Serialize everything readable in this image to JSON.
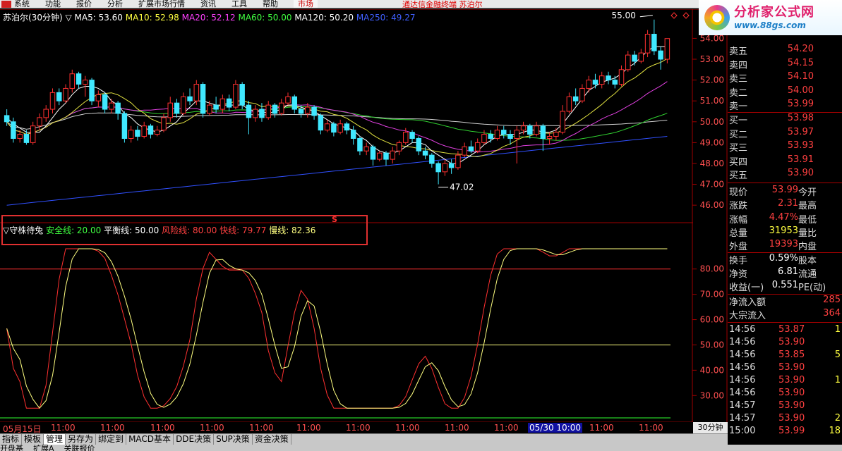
{
  "menubar": {
    "items": [
      "系统",
      "功能",
      "报价",
      "分析",
      "扩展市场行情",
      "资讯",
      "工具",
      "帮助"
    ],
    "market": "市场",
    "title": "通达信金融终端 苏泊尔"
  },
  "brand": {
    "name": "分析家公式网",
    "url": "www.88gs.com"
  },
  "main_chart": {
    "title": "苏泊尔(30分钟) ▽",
    "ma": [
      {
        "label": "MA5: 53.60",
        "color": "#ffffff"
      },
      {
        "label": "MA10: 52.98",
        "color": "#ffff40"
      },
      {
        "label": "MA20: 52.12",
        "color": "#ff40ff"
      },
      {
        "label": "MA60: 50.00",
        "color": "#40ff40"
      },
      {
        "label": "MA120: 50.20",
        "color": "#ffffff"
      },
      {
        "label": "MA250: 49.27",
        "color": "#4060ff"
      }
    ],
    "high_label": "55.00",
    "low_label": "47.02",
    "signal": "S",
    "yticks": [
      "54.00",
      "53.00",
      "52.00",
      "51.00",
      "50.00",
      "49.00",
      "48.00",
      "47.00",
      "46.00"
    ]
  },
  "indicator": {
    "title": "▽守株待兔",
    "lines": [
      {
        "label": "安全线: 20.00",
        "color": "#40ff40"
      },
      {
        "label": "平衡线: 50.00",
        "color": "#ffffff"
      },
      {
        "label": "风险线: 80.00",
        "color": "#ff4040"
      },
      {
        "label": "快线: 79.77",
        "color": "#ff4040"
      },
      {
        "label": "慢线: 82.36",
        "color": "#ffff80"
      }
    ],
    "yticks": [
      "80.00",
      "70.00",
      "60.00",
      "50.00",
      "40.00",
      "30.00"
    ]
  },
  "x_axis": {
    "labels": [
      "05月15日",
      "11:00",
      "11:00",
      "11:00",
      "11:00",
      "11:00",
      "11:00",
      "11:00",
      "11:00",
      "11:00",
      "11:00",
      "05/30 10:00",
      "11:00",
      "11:00",
      "11:00"
    ],
    "period": "30分钟"
  },
  "order_book": [
    {
      "label": "卖五",
      "price": "54.20"
    },
    {
      "label": "卖四",
      "price": "54.15"
    },
    {
      "label": "卖三",
      "price": "54.10"
    },
    {
      "label": "卖二",
      "price": "54.00"
    },
    {
      "label": "卖一",
      "price": "53.99"
    },
    {
      "label": "买一",
      "price": "53.98"
    },
    {
      "label": "买二",
      "price": "53.97"
    },
    {
      "label": "买三",
      "price": "53.93"
    },
    {
      "label": "买四",
      "price": "53.91"
    },
    {
      "label": "买五",
      "price": "53.90"
    }
  ],
  "quote": [
    {
      "l": "现价",
      "v": "53.99",
      "vc": "red",
      "r": "今开"
    },
    {
      "l": "涨跌",
      "v": "2.31",
      "vc": "red",
      "r": "最高"
    },
    {
      "l": "涨幅",
      "v": "4.47%",
      "vc": "red",
      "r": "最低"
    },
    {
      "l": "总量",
      "v": "31953",
      "vc": "yel",
      "r": "量比"
    },
    {
      "l": "外盘",
      "v": "19393",
      "vc": "red",
      "r": "内盘"
    },
    {
      "l": "换手",
      "v": "0.59%",
      "vc": "wht",
      "r": "股本"
    },
    {
      "l": "净资",
      "v": "6.81",
      "vc": "wht",
      "r": "流通"
    },
    {
      "l": "收益(一)",
      "v": "0.551",
      "vc": "wht",
      "r": "PE(动)"
    }
  ],
  "flows": [
    {
      "l": "净流入额",
      "v": "285"
    },
    {
      "l": "大宗流入",
      "v": "364"
    }
  ],
  "ticks": [
    {
      "t": "14:56",
      "p": "53.87",
      "q": "1"
    },
    {
      "t": "14:56",
      "p": "53.90",
      "q": ""
    },
    {
      "t": "14:56",
      "p": "53.85",
      "q": "5"
    },
    {
      "t": "14:56",
      "p": "53.90",
      "q": ""
    },
    {
      "t": "14:56",
      "p": "53.90",
      "q": "1"
    },
    {
      "t": "14:56",
      "p": "53.90",
      "q": ""
    },
    {
      "t": "14:57",
      "p": "53.90",
      "q": ""
    },
    {
      "t": "14:57",
      "p": "53.90",
      "q": "2"
    },
    {
      "t": "15:00",
      "p": "53.99",
      "q": "18"
    }
  ],
  "bottom_tabs": [
    "指标",
    "模板",
    "管理",
    "另存为",
    "绑定到",
    "MACD基本",
    "DDE决策",
    "SUP决策",
    "资金决策"
  ],
  "bottom_tabs2": [
    "开盘基",
    "扩展A",
    "关联报价"
  ],
  "scroll": {
    "prev": "-",
    "next": "+"
  },
  "chart_data": {
    "type": "candlestick",
    "price_range": [
      45.6,
      55.4
    ],
    "candles": [
      [
        50.3,
        50.0,
        50.6,
        49.8
      ],
      [
        50.0,
        49.2,
        50.2,
        49.0
      ],
      [
        49.2,
        49.4,
        49.6,
        49.0
      ],
      [
        49.4,
        49.0,
        49.6,
        48.9
      ],
      [
        49.0,
        49.8,
        50.0,
        48.9
      ],
      [
        49.8,
        50.2,
        50.4,
        49.6
      ],
      [
        50.2,
        50.6,
        50.8,
        50.0
      ],
      [
        50.6,
        51.4,
        51.6,
        50.4
      ],
      [
        51.4,
        51.0,
        51.6,
        50.8
      ],
      [
        51.0,
        51.6,
        51.8,
        50.9
      ],
      [
        51.6,
        52.3,
        52.5,
        51.4
      ],
      [
        52.3,
        51.8,
        52.4,
        51.6
      ],
      [
        51.8,
        52.0,
        52.2,
        51.2
      ],
      [
        52.0,
        51.0,
        52.1,
        50.8
      ],
      [
        51.0,
        51.3,
        51.5,
        50.7
      ],
      [
        51.3,
        50.6,
        51.4,
        50.4
      ],
      [
        50.6,
        50.9,
        51.1,
        50.4
      ],
      [
        50.9,
        50.4,
        51.0,
        50.1
      ],
      [
        50.4,
        49.2,
        50.5,
        49.0
      ],
      [
        49.2,
        49.6,
        49.8,
        49.0
      ],
      [
        49.6,
        49.3,
        49.8,
        49.1
      ],
      [
        49.3,
        49.8,
        50.0,
        49.2
      ],
      [
        49.8,
        49.4,
        49.9,
        49.2
      ],
      [
        49.4,
        49.6,
        49.8,
        49.3
      ],
      [
        49.6,
        50.2,
        50.4,
        49.5
      ],
      [
        50.2,
        50.9,
        51.2,
        50.0
      ],
      [
        50.9,
        50.4,
        51.1,
        50.2
      ],
      [
        50.4,
        51.2,
        51.4,
        50.3
      ],
      [
        51.2,
        51.0,
        51.6,
        50.8
      ],
      [
        51.0,
        51.8,
        52.0,
        50.8
      ],
      [
        51.8,
        50.4,
        51.9,
        50.2
      ],
      [
        50.4,
        50.8,
        51.0,
        50.3
      ],
      [
        50.8,
        50.6,
        51.2,
        50.4
      ],
      [
        50.6,
        51.1,
        51.3,
        50.4
      ],
      [
        51.1,
        50.7,
        51.3,
        50.5
      ],
      [
        50.7,
        51.8,
        52.0,
        50.6
      ],
      [
        51.8,
        50.8,
        51.9,
        50.6
      ],
      [
        50.8,
        50.2,
        51.0,
        49.4
      ],
      [
        50.2,
        50.6,
        50.8,
        50.0
      ],
      [
        50.6,
        50.2,
        50.9,
        50.0
      ],
      [
        50.2,
        50.8,
        51.0,
        50.1
      ],
      [
        50.8,
        50.4,
        50.9,
        50.2
      ],
      [
        50.4,
        50.9,
        51.1,
        50.3
      ],
      [
        50.9,
        51.2,
        51.4,
        50.8
      ],
      [
        51.2,
        50.6,
        51.3,
        50.4
      ],
      [
        50.6,
        50.4,
        50.8,
        50.2
      ],
      [
        50.4,
        50.7,
        50.9,
        50.2
      ],
      [
        50.7,
        50.3,
        50.8,
        50.1
      ],
      [
        50.3,
        49.6,
        50.4,
        49.4
      ],
      [
        49.6,
        49.9,
        50.1,
        49.5
      ],
      [
        49.9,
        49.5,
        50.0,
        49.3
      ],
      [
        49.5,
        49.9,
        50.1,
        49.4
      ],
      [
        49.9,
        49.6,
        50.0,
        49.4
      ],
      [
        49.6,
        49.2,
        49.8,
        48.9
      ],
      [
        49.2,
        48.6,
        49.3,
        48.4
      ],
      [
        48.6,
        48.8,
        49.0,
        48.4
      ],
      [
        48.8,
        48.2,
        48.9,
        47.9
      ],
      [
        48.2,
        48.5,
        48.6,
        48.1
      ],
      [
        48.5,
        48.2,
        48.6,
        47.9
      ],
      [
        48.2,
        48.6,
        48.8,
        48.0
      ],
      [
        48.6,
        49.0,
        49.1,
        48.4
      ],
      [
        49.0,
        49.5,
        49.7,
        48.9
      ],
      [
        49.5,
        49.2,
        49.6,
        49.0
      ],
      [
        49.2,
        48.6,
        49.3,
        48.4
      ],
      [
        48.6,
        48.4,
        48.8,
        48.2
      ],
      [
        48.4,
        48.0,
        48.5,
        47.8
      ],
      [
        48.0,
        47.6,
        48.1,
        47.0
      ],
      [
        47.6,
        48.0,
        48.2,
        47.4
      ],
      [
        48.0,
        47.8,
        48.2,
        47.5
      ],
      [
        47.8,
        48.4,
        48.6,
        47.7
      ],
      [
        48.4,
        48.8,
        49.0,
        48.3
      ],
      [
        48.8,
        48.6,
        49.1,
        48.5
      ],
      [
        48.6,
        49.0,
        49.2,
        48.5
      ],
      [
        49.0,
        49.4,
        49.6,
        48.9
      ],
      [
        49.4,
        49.2,
        49.6,
        49.0
      ],
      [
        49.2,
        49.6,
        49.8,
        49.1
      ],
      [
        49.6,
        49.4,
        49.8,
        49.2
      ],
      [
        49.4,
        49.2,
        49.6,
        48.9
      ],
      [
        49.2,
        49.6,
        49.8,
        48.0
      ],
      [
        49.6,
        49.8,
        50.0,
        49.4
      ],
      [
        49.8,
        49.4,
        49.9,
        49.2
      ],
      [
        49.4,
        49.8,
        50.0,
        49.3
      ],
      [
        49.8,
        49.2,
        49.9,
        48.6
      ],
      [
        49.2,
        49.3,
        49.5,
        48.9
      ],
      [
        49.3,
        49.5,
        49.7,
        49.1
      ],
      [
        49.5,
        50.5,
        50.8,
        49.4
      ],
      [
        50.5,
        51.2,
        51.4,
        50.4
      ],
      [
        51.2,
        51.0,
        51.6,
        50.8
      ],
      [
        51.0,
        51.6,
        51.8,
        50.9
      ],
      [
        51.6,
        52.0,
        52.2,
        51.4
      ],
      [
        52.0,
        51.8,
        52.3,
        51.6
      ],
      [
        51.8,
        52.2,
        52.4,
        51.6
      ],
      [
        52.2,
        52.0,
        52.4,
        51.8
      ],
      [
        52.0,
        51.8,
        52.2,
        51.6
      ],
      [
        51.8,
        52.5,
        52.7,
        51.7
      ],
      [
        52.5,
        53.2,
        53.4,
        52.4
      ],
      [
        53.2,
        52.9,
        53.4,
        52.7
      ],
      [
        52.9,
        53.3,
        53.5,
        52.8
      ],
      [
        53.3,
        54.2,
        54.4,
        53.1
      ],
      [
        54.2,
        53.4,
        54.9,
        53.2
      ],
      [
        53.4,
        53.0,
        53.6,
        52.5
      ],
      [
        53.0,
        53.99,
        54.0,
        52.8
      ]
    ],
    "ma5": [
      50.2,
      49.9,
      49.7,
      49.5,
      49.5,
      49.5,
      49.8,
      50.2,
      50.6,
      50.9,
      51.3,
      51.6,
      51.7,
      51.7,
      51.6,
      51.4,
      51.0,
      50.8,
      50.4,
      50.2,
      49.9,
      49.7,
      49.6,
      49.5,
      49.6,
      49.8,
      50.0,
      50.4,
      50.7,
      51.0,
      51.0,
      50.9,
      50.8,
      50.8,
      50.8,
      50.8,
      50.8,
      50.6,
      50.5,
      50.5,
      50.4,
      50.5,
      50.6,
      50.8,
      50.8,
      50.7,
      50.6,
      50.5,
      50.3,
      50.1,
      49.9,
      49.8,
      49.7,
      49.6,
      49.3,
      49.1,
      48.8,
      48.6,
      48.5,
      48.5,
      48.6,
      48.8,
      49.0,
      49.0,
      48.9,
      48.6,
      48.4,
      48.2,
      48.0,
      48.0,
      48.2,
      48.4,
      48.6,
      48.9,
      49.1,
      49.3,
      49.4,
      49.4,
      49.4,
      49.5,
      49.6,
      49.6,
      49.5,
      49.5,
      49.6,
      49.9,
      50.3,
      50.7,
      51.1,
      51.5,
      51.7,
      51.9,
      52.0,
      52.1,
      52.3,
      52.6,
      52.8,
      53.1,
      53.4,
      53.6,
      53.6,
      53.6
    ]
  }
}
